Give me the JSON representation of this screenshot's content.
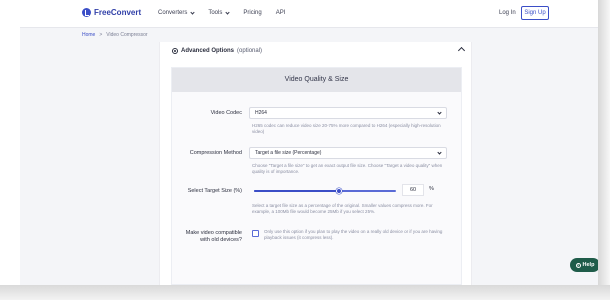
{
  "brand": {
    "name": "FreeConvert",
    "accent": "#3b4ec7"
  },
  "nav": {
    "converters": "Converters",
    "tools": "Tools",
    "pricing": "Pricing",
    "api": "API",
    "login": "Log In",
    "signup": "Sign Up"
  },
  "breadcrumb": {
    "home": "Home",
    "separator": ">",
    "current": "Video Compressor"
  },
  "advanced": {
    "title": "Advanced Options",
    "optional": "(optional)"
  },
  "panel": {
    "title": "Video Quality & Size",
    "codec": {
      "label": "Video Codec",
      "value": "H264",
      "help": "H265 codec can reduce video size 20-75% more compared to H264 (especially high-resolution video)"
    },
    "method": {
      "label": "Compression Method",
      "value": "Target a file size (Percentage)",
      "help": "Choose \"Target a file size\" to get an exact output file size. Choose \"Target a video quality\" when quality is of importance."
    },
    "target": {
      "label": "Select Target Size (%)",
      "value": "60",
      "percent_symbol": "%",
      "level": 0.6,
      "help": "Select a target file size as a percentage of the original. Smaller values compress more. For example, a 100Mb file would become 25Mb if you select 25%."
    },
    "compat": {
      "label": "Make video compatible with old devices?",
      "checked": false,
      "help": "Only use this option if you plan to play the video on a really old device or if you are having playback issues (it compress less)."
    }
  },
  "help_button": {
    "label": "Help"
  }
}
